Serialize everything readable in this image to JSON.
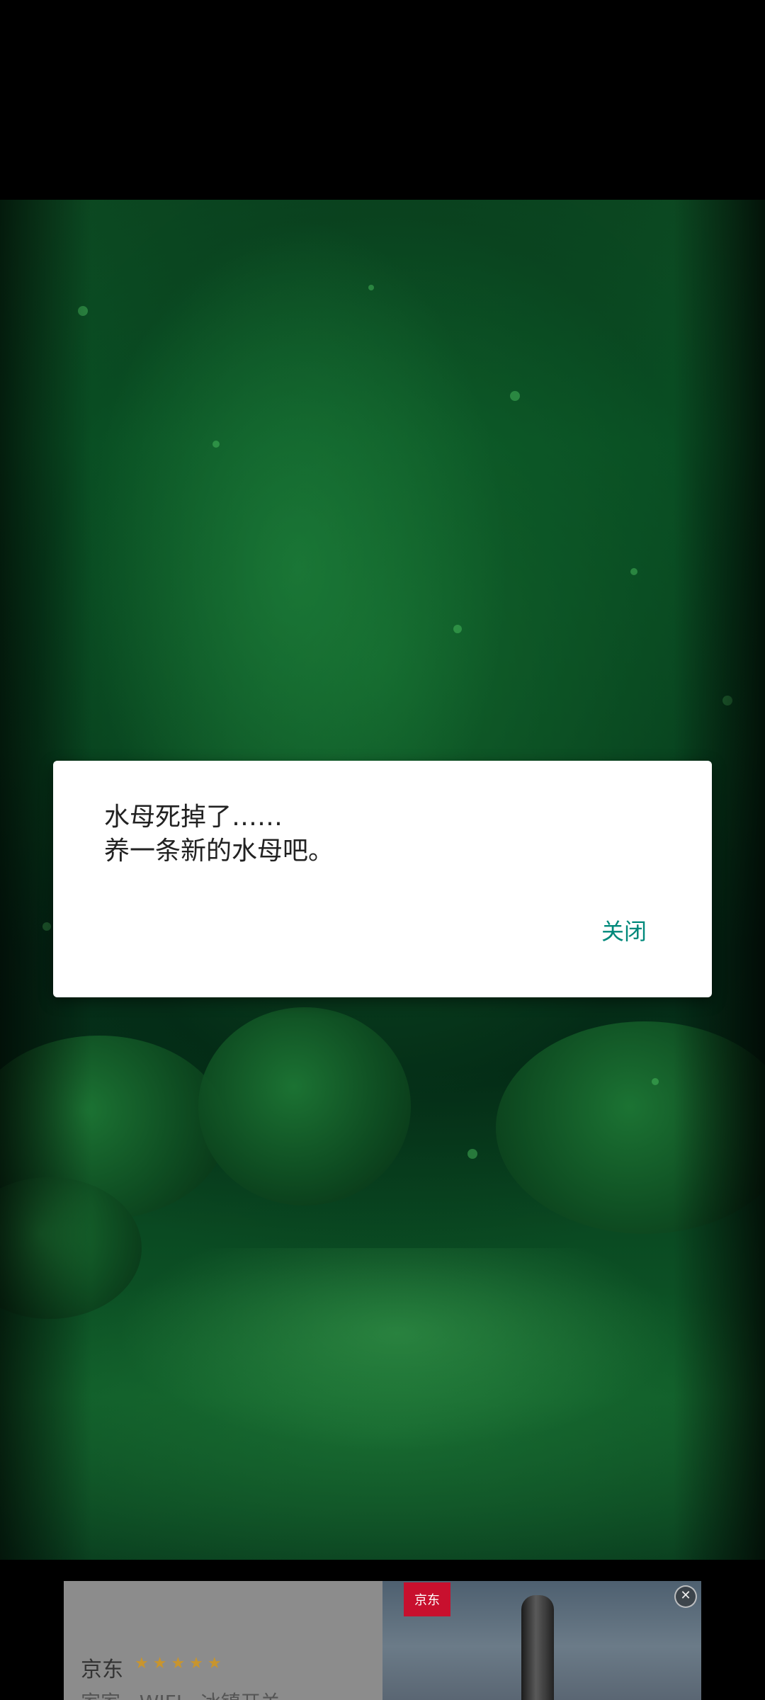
{
  "dialog": {
    "message": "水母死掉了……\n养一条新的水母吧。",
    "close_label": "关闭"
  },
  "ad": {
    "brand": "京东",
    "stars": "★★★★★",
    "logo_text": "京东",
    "description": "家家 · WIFI · 冰镇开关",
    "close_icon": "close-icon"
  },
  "colors": {
    "accent": "#00897b",
    "scene_green": "#0b5a28"
  }
}
